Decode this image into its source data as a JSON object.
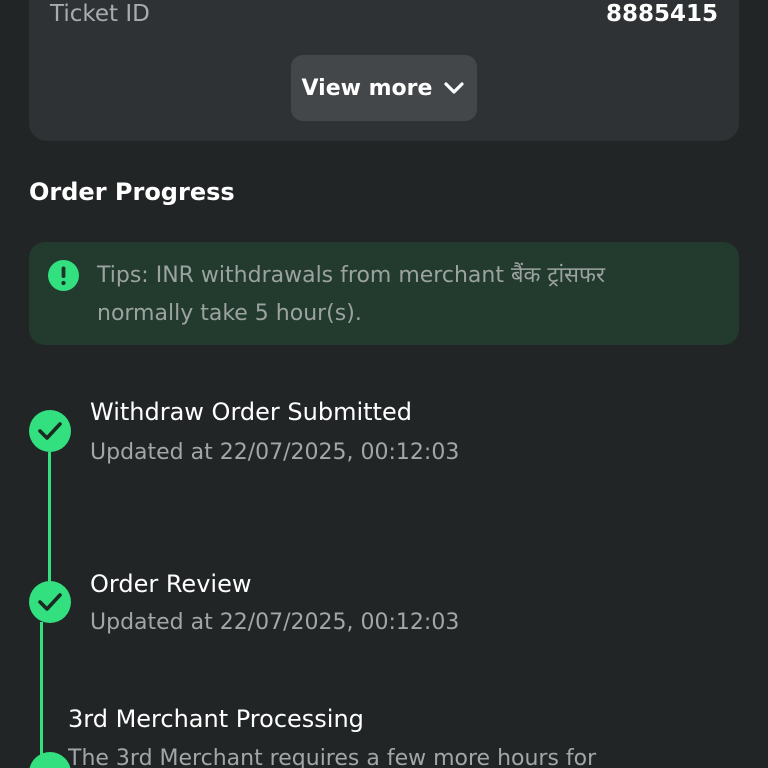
{
  "details": {
    "ticket_label": "Ticket ID",
    "ticket_value": "8885415",
    "view_more_label": "View more"
  },
  "order_progress": {
    "title": "Order Progress",
    "tips_line1": "Tips: INR withdrawals from merchant बैंक ट्रांसफर",
    "tips_line2": "normally take 5 hour(s).",
    "steps": [
      {
        "title": "Withdraw Order Submitted",
        "subtitle": "Updated at 22/07/2025, 00:12:03",
        "status": "completed"
      },
      {
        "title": "Order Review",
        "subtitle": "Updated at 22/07/2025, 00:12:03",
        "status": "completed"
      },
      {
        "title": "3rd Merchant Processing",
        "subtitle": "The 3rd Merchant requires a few more hours for",
        "status": "completed"
      }
    ]
  },
  "colors": {
    "background": "#222526",
    "card": "#2f3234",
    "accent_green": "#33e07f",
    "tips_background": "#233a2e"
  },
  "icons": {
    "view_more": "chevron-down-icon",
    "tips": "exclamation-circle-icon",
    "step": "check-circle-icon"
  }
}
